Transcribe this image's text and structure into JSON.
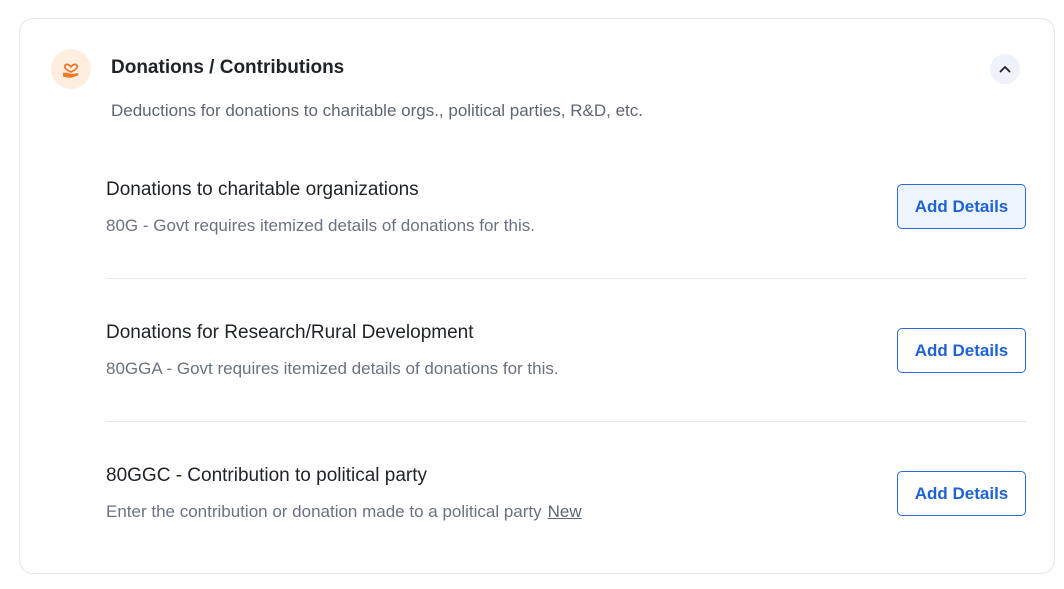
{
  "section": {
    "icon": "donation-heart-hand-icon",
    "title": "Donations / Contributions",
    "subtitle": "Deductions for donations to charitable orgs., political parties, R&D, etc.",
    "collapse_icon": "chevron-up-icon"
  },
  "items": [
    {
      "title": "Donations to charitable organizations",
      "description": "80G - Govt requires itemized details of donations for this.",
      "button_label": "Add Details"
    },
    {
      "title": "Donations for Research/Rural Development",
      "description": "80GGA - Govt requires itemized details of donations for this.",
      "button_label": "Add Details"
    },
    {
      "title": "80GGC - Contribution to political party",
      "description": "Enter the contribution or donation made to a political party",
      "badge": "New",
      "button_label": "Add Details"
    }
  ],
  "colors": {
    "accent": "#1e63d0",
    "icon_bg": "#fdeee0",
    "icon_fg": "#f07a2a"
  }
}
